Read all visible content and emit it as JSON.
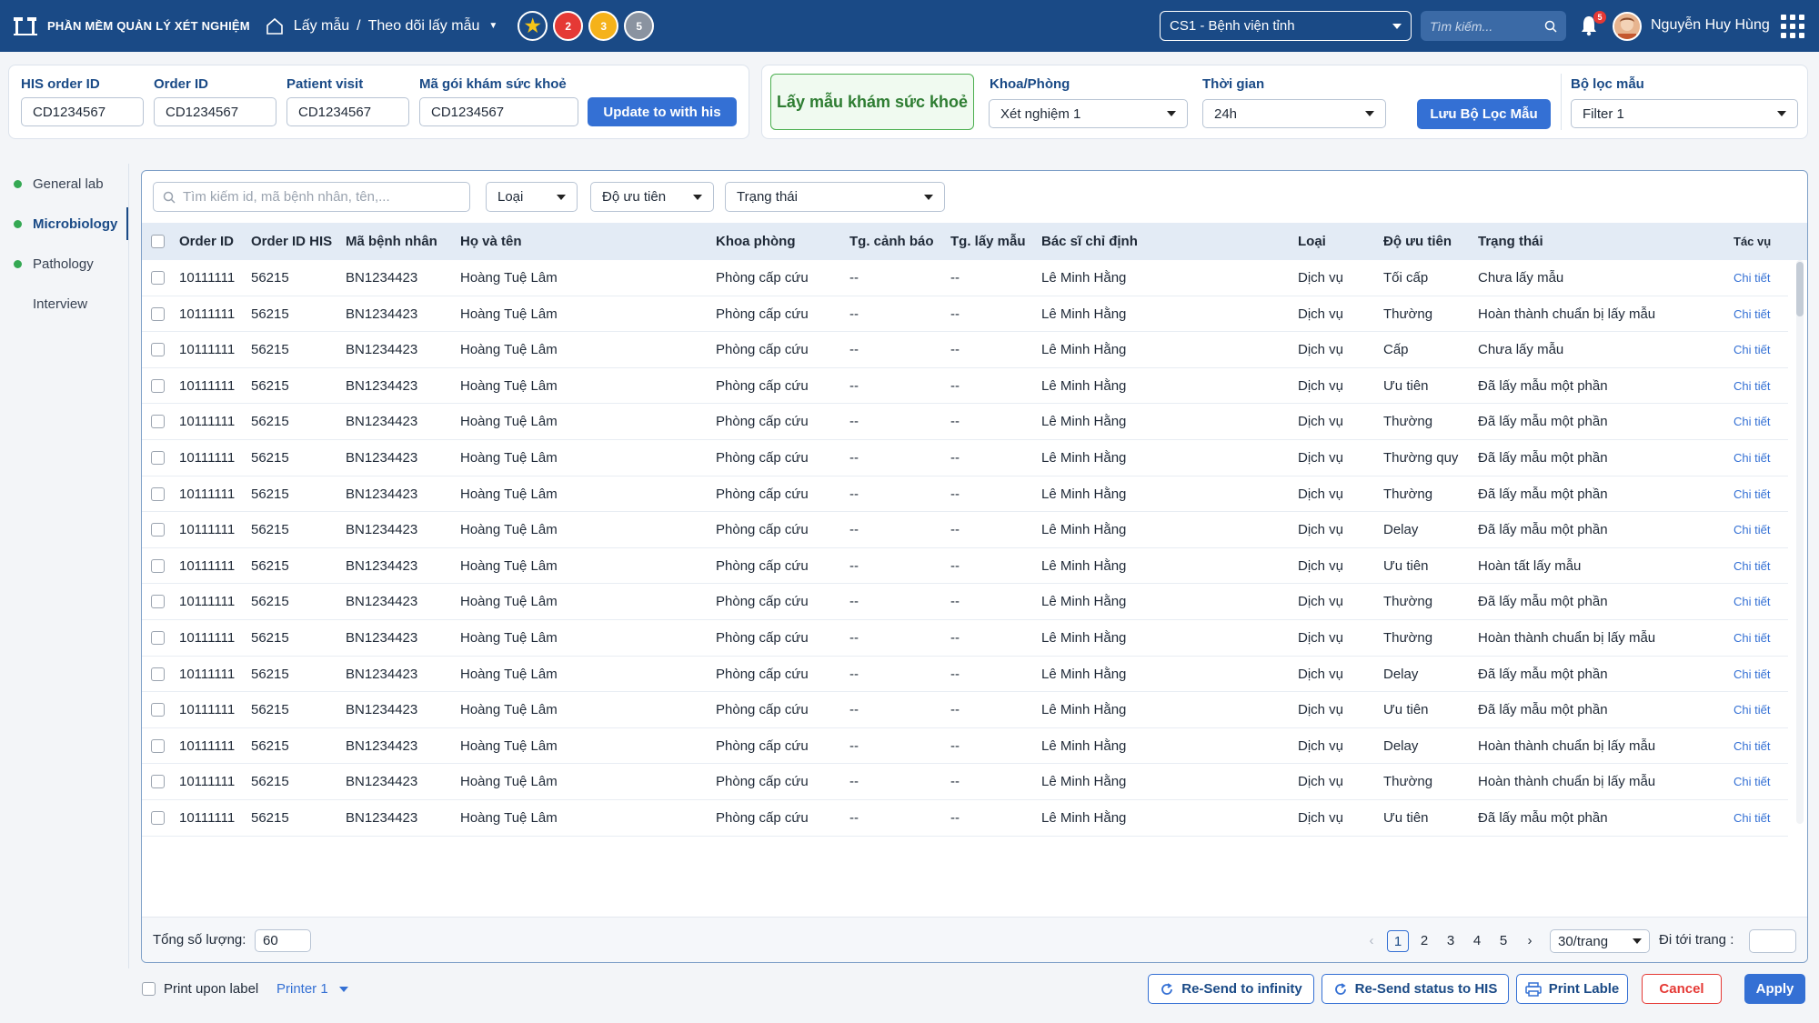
{
  "app": {
    "title": "PHẦN MỀM QUẢN LÝ XÉT NGHIỆM"
  },
  "breadcrumb": {
    "root": "Lấy mẫu",
    "current": "Theo dõi lấy mẫu"
  },
  "quick_badges": [
    {
      "icon": "star-icon",
      "label": ""
    },
    {
      "label": "2",
      "color": "#e53935"
    },
    {
      "label": "3",
      "color": "#f5b21a"
    },
    {
      "label": "5",
      "color": "#8a93a0"
    }
  ],
  "site_select": {
    "value": "CS1 - Bệnh viện tỉnh"
  },
  "top_search": {
    "placeholder": "Tìm kiếm..."
  },
  "notifications": {
    "count": "5"
  },
  "user": {
    "name": "Nguyễn Huy Hùng"
  },
  "order_filters": {
    "his_order_id": {
      "label": "HIS order ID",
      "value": "CD1234567"
    },
    "order_id": {
      "label": "Order ID",
      "value": "CD1234567"
    },
    "patient_visit": {
      "label": "Patient visit",
      "value": "CD1234567"
    },
    "package_code": {
      "label": "Mã gói khám sức khoẻ",
      "value": "CD1234567"
    },
    "update_button": "Update to with his"
  },
  "health_filters": {
    "health_sampling": "Lấy mẫu khám sức khoẻ",
    "department": {
      "label": "Khoa/Phòng",
      "value": "Xét nghiệm 1"
    },
    "time": {
      "label": "Thời gian",
      "value": "24h"
    },
    "save_button": "Lưu Bộ Lọc Mẫu",
    "filter_set": {
      "label": "Bộ lọc mẫu",
      "value": "Filter 1"
    }
  },
  "sidebar": {
    "items": [
      {
        "label": "General lab",
        "dot": true
      },
      {
        "label": "Microbiology",
        "dot": true,
        "active": true
      },
      {
        "label": "Pathology",
        "dot": true
      },
      {
        "label": "Interview",
        "dot": false
      }
    ]
  },
  "table_filters": {
    "search_placeholder": "Tìm kiếm id, mã bệnh nhân, tên,...",
    "type": "Loại",
    "priority": "Độ ưu tiên",
    "status": "Trạng thái"
  },
  "table": {
    "columns": [
      "Order ID",
      "Order ID HIS",
      "Mã bệnh nhân",
      "Họ và tên",
      "Khoa phòng",
      "Tg. cảnh báo",
      "Tg. lấy mẫu",
      "Bác sĩ chỉ định",
      "Loại",
      "Độ ưu tiên",
      "Trạng thái",
      "Tác vụ"
    ],
    "rows": [
      [
        "10111111",
        "56215",
        "BN1234423",
        "Hoàng Tuệ Lâm",
        "Phòng cấp cứu",
        "--",
        "--",
        "Lê Minh Hằng",
        "Dịch vụ",
        "Tối cấp",
        "Chưa lấy mẫu",
        "Chi tiết"
      ],
      [
        "10111111",
        "56215",
        "BN1234423",
        "Hoàng Tuệ Lâm",
        "Phòng cấp cứu",
        "--",
        "--",
        "Lê Minh Hằng",
        "Dịch vụ",
        "Thường",
        "Hoàn thành chuẩn bị lấy mẫu",
        "Chi tiết"
      ],
      [
        "10111111",
        "56215",
        "BN1234423",
        "Hoàng Tuệ Lâm",
        "Phòng cấp cứu",
        "--",
        "--",
        "Lê Minh Hằng",
        "Dịch vụ",
        "Cấp",
        "Chưa lấy mẫu",
        "Chi tiết"
      ],
      [
        "10111111",
        "56215",
        "BN1234423",
        "Hoàng Tuệ Lâm",
        "Phòng cấp cứu",
        "--",
        "--",
        "Lê Minh Hằng",
        "Dịch vụ",
        "Ưu tiên",
        "Đã lấy mẫu một phần",
        "Chi tiết"
      ],
      [
        "10111111",
        "56215",
        "BN1234423",
        "Hoàng Tuệ Lâm",
        "Phòng cấp cứu",
        "--",
        "--",
        "Lê Minh Hằng",
        "Dịch vụ",
        "Thường",
        "Đã lấy mẫu một phần",
        "Chi tiết"
      ],
      [
        "10111111",
        "56215",
        "BN1234423",
        "Hoàng Tuệ Lâm",
        "Phòng cấp cứu",
        "--",
        "--",
        "Lê Minh Hằng",
        "Dịch vụ",
        "Thường quy",
        "Đã lấy mẫu một phần",
        "Chi tiết"
      ],
      [
        "10111111",
        "56215",
        "BN1234423",
        "Hoàng Tuệ Lâm",
        "Phòng cấp cứu",
        "--",
        "--",
        "Lê Minh Hằng",
        "Dịch vụ",
        "Thường",
        "Đã lấy mẫu một phần",
        "Chi tiết"
      ],
      [
        "10111111",
        "56215",
        "BN1234423",
        "Hoàng Tuệ Lâm",
        "Phòng cấp cứu",
        "--",
        "--",
        "Lê Minh Hằng",
        "Dịch vụ",
        "Delay",
        "Đã lấy mẫu một phần",
        "Chi tiết"
      ],
      [
        "10111111",
        "56215",
        "BN1234423",
        "Hoàng Tuệ Lâm",
        "Phòng cấp cứu",
        "--",
        "--",
        "Lê Minh Hằng",
        "Dịch vụ",
        "Ưu tiên",
        "Hoàn tất lấy mẫu",
        "Chi tiết"
      ],
      [
        "10111111",
        "56215",
        "BN1234423",
        "Hoàng Tuệ Lâm",
        "Phòng cấp cứu",
        "--",
        "--",
        "Lê Minh Hằng",
        "Dịch vụ",
        "Thường",
        "Đã lấy mẫu một phần",
        "Chi tiết"
      ],
      [
        "10111111",
        "56215",
        "BN1234423",
        "Hoàng Tuệ Lâm",
        "Phòng cấp cứu",
        "--",
        "--",
        "Lê Minh Hằng",
        "Dịch vụ",
        "Thường",
        "Hoàn thành chuẩn bị lấy mẫu",
        "Chi tiết"
      ],
      [
        "10111111",
        "56215",
        "BN1234423",
        "Hoàng Tuệ Lâm",
        "Phòng cấp cứu",
        "--",
        "--",
        "Lê Minh Hằng",
        "Dịch vụ",
        "Delay",
        "Đã lấy mẫu một phần",
        "Chi tiết"
      ],
      [
        "10111111",
        "56215",
        "BN1234423",
        "Hoàng Tuệ Lâm",
        "Phòng cấp cứu",
        "--",
        "--",
        "Lê Minh Hằng",
        "Dịch vụ",
        "Ưu tiên",
        "Đã lấy mẫu một phần",
        "Chi tiết"
      ],
      [
        "10111111",
        "56215",
        "BN1234423",
        "Hoàng Tuệ Lâm",
        "Phòng cấp cứu",
        "--",
        "--",
        "Lê Minh Hằng",
        "Dịch vụ",
        "Delay",
        "Hoàn thành chuẩn bị lấy mẫu",
        "Chi tiết"
      ],
      [
        "10111111",
        "56215",
        "BN1234423",
        "Hoàng Tuệ Lâm",
        "Phòng cấp cứu",
        "--",
        "--",
        "Lê Minh Hằng",
        "Dịch vụ",
        "Thường",
        "Hoàn thành chuẩn bị lấy mẫu",
        "Chi tiết"
      ],
      [
        "10111111",
        "56215",
        "BN1234423",
        "Hoàng Tuệ Lâm",
        "Phòng cấp cứu",
        "--",
        "--",
        "Lê Minh Hằng",
        "Dịch vụ",
        "Ưu tiên",
        "Đã lấy mẫu một phần",
        "Chi tiết"
      ]
    ]
  },
  "footer": {
    "total_label": "Tổng số lượng:",
    "total_value": "60",
    "pages": [
      "1",
      "2",
      "3",
      "4",
      "5"
    ],
    "current_page": "1",
    "page_size": "30/trang",
    "goto_label": "Đi tới trang :",
    "goto_value": ""
  },
  "bottom_bar": {
    "print_label": "Print upon label",
    "printer": "Printer 1",
    "resend_infinity": "Re-Send to infinity",
    "resend_his": "Re-Send status to HIS",
    "print_lable": "Print Lable",
    "cancel": "Cancel",
    "apply": "Apply"
  },
  "colors": {
    "primary": "#1a4a86",
    "accent": "#3470d4",
    "danger": "#e53935",
    "success": "#34a853"
  }
}
